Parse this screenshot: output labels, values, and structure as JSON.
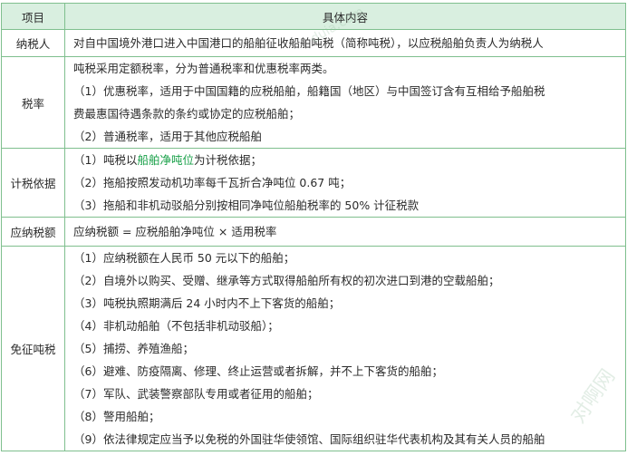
{
  "header": {
    "col_item": "项目",
    "col_content": "具体内容"
  },
  "rows": {
    "taxpayer": {
      "item": "纳税人",
      "lines": [
        "对自中国境外港口进入中国港口的船舶征收船舶吨税（简称吨税），以应税船舶负责人为纳税人"
      ]
    },
    "rate": {
      "item": "税率",
      "lines": [
        "吨税采用定额税率，分为普通税率和优惠税率两类。",
        "（1）优惠税率，适用于中国国籍的应税船舶，船籍国（地区）与中国签订含有互相给予船舶税",
        "费最惠国待遇条款的条约或协定的应税船舶；",
        "（2）普通税率，适用于其他应税船舶"
      ]
    },
    "basis": {
      "item": "计税依据",
      "line1_prefix": "（1）吨税以",
      "line1_highlight": "船舶净吨位",
      "line1_suffix": "为计税依据；",
      "lines": [
        "（2）拖船按照发动机功率每千瓦折合净吨位 0.67 吨；",
        "（3）拖船和非机动驳船分别按相同净吨位船舶税率的 50% 计征税款"
      ]
    },
    "payable": {
      "item": "应纳税额",
      "lines": [
        "应纳税额 = 应税船舶净吨位 × 适用税率"
      ]
    },
    "exempt": {
      "item": "免征吨税",
      "lines": [
        "（1）应纳税额在人民币 50 元以下的船舶；",
        "（2）自境外以购买、受赠、继承等方式取得船舶所有权的初次进口到港的空载船舶；",
        "（3）吨税执照期满后 24 小时内不上下客货的船舶；",
        "（4）非机动船舶（不包括非机动驳船）；",
        "（5）捕捞、养殖渔船；",
        "（6）避难、防疫隔离、修理、终止运营或者拆解，并不上下客货的船舶；",
        "（7）军队、武装警察部队专用或者征用的船舶；",
        "（8）警用船舶；",
        "（9）依法律规定应当予以免税的外国驻华使领馆、国际组织驻华代表机构及其有关人员的船舶"
      ]
    }
  },
  "watermark": {
    "text1": "对啊网",
    "text2": "duia.com"
  },
  "colors": {
    "border": "#7fbf8e",
    "header_bg": "#d9efe0",
    "highlight": "#1aa14a"
  }
}
